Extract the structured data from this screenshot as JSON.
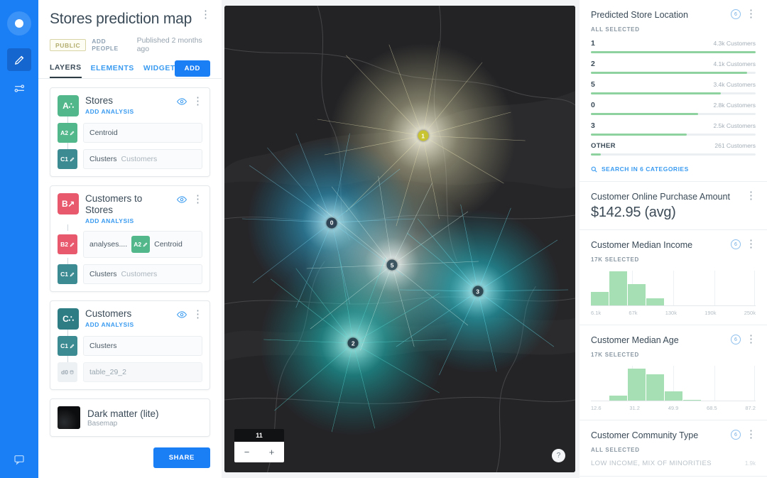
{
  "rail": {
    "logo_icon": "circle-dot-icon",
    "items": [
      {
        "icon": "pencil-icon",
        "name": "edit-tool",
        "active": true
      },
      {
        "icon": "sliders-icon",
        "name": "settings-tool",
        "active": false
      }
    ],
    "bottom_icon": "comment-icon"
  },
  "panel": {
    "title": "Stores prediction map",
    "kebab": "⋮",
    "badge_public": "PUBLIC",
    "add_people": "ADD PEOPLE",
    "published": "Published 2 months ago",
    "tabs": [
      {
        "label": "LAYERS",
        "active": true
      },
      {
        "label": "ELEMENTS",
        "active": false
      },
      {
        "label": "WIDGETS",
        "active": false
      }
    ],
    "add_button": "ADD",
    "share_button": "SHARE",
    "layers": [
      {
        "tile": "A",
        "tile_glyph": "A∴",
        "tile_color": "green",
        "name": "Stores",
        "sub": "ADD ANALYSIS",
        "rows": [
          {
            "chip": "A2",
            "chip_color": "green",
            "label": "Centroid",
            "muted": ""
          },
          {
            "chip": "C1",
            "chip_color": "teal",
            "label": "Clusters",
            "muted": "Customers"
          }
        ]
      },
      {
        "tile": "B",
        "tile_glyph": "B↗",
        "tile_color": "pink",
        "name": "Customers to Stores",
        "sub": "ADD ANALYSIS",
        "rows": [
          {
            "chip": "B2",
            "chip_color": "pink",
            "label": "analyses....",
            "muted": "",
            "second_chip": "A2",
            "second_chip_color": "green",
            "second_label": "Centroid"
          },
          {
            "chip": "C1",
            "chip_color": "teal",
            "label": "Clusters",
            "muted": "Customers"
          }
        ]
      },
      {
        "tile": "C",
        "tile_glyph": "C∴",
        "tile_color": "dark",
        "name": "Customers",
        "sub": "ADD ANALYSIS",
        "rows": [
          {
            "chip": "C1",
            "chip_color": "teal",
            "label": "Clusters",
            "muted": ""
          },
          {
            "chip": "d0",
            "chip_color": "grey",
            "label": "table_29_2",
            "muted": "",
            "plain": true
          }
        ]
      }
    ],
    "basemap": {
      "name": "Dark matter (lite)",
      "sub": "Basemap"
    }
  },
  "map": {
    "zoom_level": "11",
    "zoom_out": "−",
    "zoom_in": "+",
    "help": "?",
    "markers": [
      {
        "label": "1",
        "x": 56.6,
        "y": 27.9,
        "color": "#c8c431"
      },
      {
        "label": "0",
        "x": 30.6,
        "y": 46.5,
        "color": "#2f4454"
      },
      {
        "label": "5",
        "x": 47.8,
        "y": 55.6,
        "color": "#3c5560"
      },
      {
        "label": "3",
        "x": 72.2,
        "y": 61.2,
        "color": "#2f4a55"
      },
      {
        "label": "2",
        "x": 36.7,
        "y": 72.3,
        "color": "#2b4651"
      }
    ]
  },
  "right": {
    "widgets": [
      {
        "title": "Predicted Store Location",
        "badge": "6",
        "sub": "ALL SELECTED",
        "type": "categories",
        "categories": [
          {
            "name": "1",
            "value": "4.3k Customers",
            "pct": 100
          },
          {
            "name": "2",
            "value": "4.1k Customers",
            "pct": 95
          },
          {
            "name": "5",
            "value": "3.4k Customers",
            "pct": 79
          },
          {
            "name": "0",
            "value": "2.8k Customers",
            "pct": 65
          },
          {
            "name": "3",
            "value": "2.5k Customers",
            "pct": 58
          },
          {
            "name": "OTHER",
            "value": "261 Customers",
            "pct": 6
          }
        ],
        "search": "SEARCH IN 6 CATEGORIES",
        "search_icon": "search-icon"
      },
      {
        "title": "Customer Online Purchase Amount",
        "type": "kpi",
        "kpi": "$142.95 (avg)"
      },
      {
        "title": "Customer Median Income",
        "badge": "6",
        "sub": "17K SELECTED",
        "type": "histogram"
      },
      {
        "title": "Customer Median Age",
        "badge": "6",
        "sub": "17K SELECTED",
        "type": "histogram"
      },
      {
        "title": "Customer Community Type",
        "badge": "6",
        "sub": "ALL SELECTED",
        "type": "community",
        "rows": [
          {
            "name": "LOW INCOME, MIX OF MINORITIES",
            "value": "1.9k"
          }
        ]
      }
    ]
  },
  "chart_data": [
    {
      "type": "bar",
      "title": "Predicted Store Location",
      "categories": [
        "1",
        "2",
        "5",
        "0",
        "3",
        "OTHER"
      ],
      "values": [
        4300,
        4100,
        3400,
        2800,
        2500,
        261
      ],
      "value_labels": [
        "4.3k Customers",
        "4.1k Customers",
        "3.4k Customers",
        "2.8k Customers",
        "2.5k Customers",
        "261 Customers"
      ],
      "xlabel": "",
      "ylabel": "Customers",
      "orientation": "horizontal",
      "grid": false,
      "legend": "none"
    },
    {
      "type": "histogram",
      "title": "Customer Median Income",
      "subtitle": "17K SELECTED",
      "tick_labels": [
        "6.1k",
        "67k",
        "130k",
        "190k",
        "250k"
      ],
      "bins": [
        0,
        1,
        2,
        3,
        4,
        5,
        6,
        7,
        8,
        9,
        10,
        11,
        12,
        13,
        14,
        15,
        16,
        17,
        18,
        19
      ],
      "values": [
        32,
        0,
        78,
        0,
        50,
        0,
        18,
        0,
        0,
        0,
        0,
        0,
        0,
        0,
        0,
        0,
        0,
        0,
        0,
        0
      ],
      "xlim": [
        6100,
        250000
      ],
      "ylim": [
        0,
        80
      ],
      "grid": true,
      "legend": "none"
    },
    {
      "type": "histogram",
      "title": "Customer Median Age",
      "subtitle": "17K SELECTED",
      "tick_labels": [
        "12.6",
        "31.2",
        "49.9",
        "68.5",
        "87.2"
      ],
      "bins": [
        0,
        1,
        2,
        3,
        4,
        5,
        6,
        7,
        8,
        9,
        10,
        11,
        12,
        13,
        14,
        15,
        16,
        17,
        18,
        19
      ],
      "values": [
        0,
        0,
        14,
        0,
        72,
        0,
        60,
        0,
        22,
        0,
        3,
        0,
        0,
        0,
        0,
        0,
        0,
        0,
        0,
        0
      ],
      "xlim": [
        12.6,
        87.2
      ],
      "ylim": [
        0,
        80
      ],
      "grid": true,
      "legend": "none"
    }
  ]
}
